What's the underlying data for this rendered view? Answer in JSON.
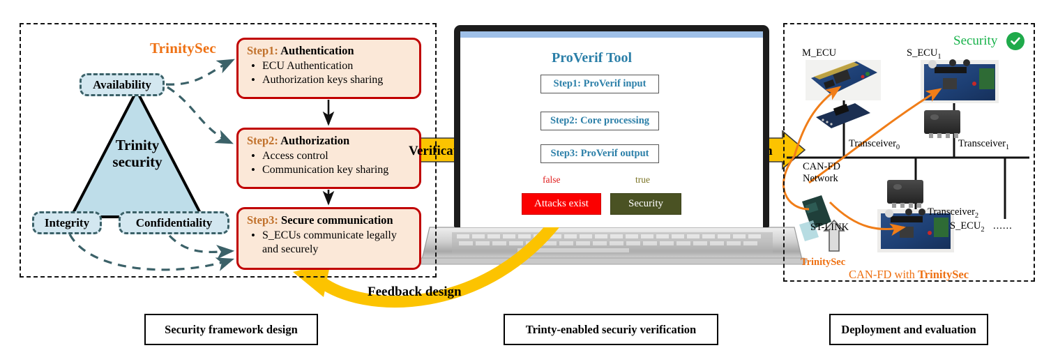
{
  "panel1": {
    "framework_title": "TrinitySec",
    "triangle_label_line1": "Trinity",
    "triangle_label_line2": "security",
    "pillars": [
      {
        "label": "Availability"
      },
      {
        "label": "Integrity"
      },
      {
        "label": "Confidentiality"
      }
    ],
    "steps": [
      {
        "step_key": "Step1:",
        "step_title": "Authentication",
        "bullets": [
          "ECU Authentication",
          "Authorization keys sharing"
        ]
      },
      {
        "step_key": "Step2:",
        "step_title": "Authorization",
        "bullets": [
          "Access control",
          "Communication key sharing"
        ]
      },
      {
        "step_key": "Step3:",
        "step_title": "Secure communication",
        "bullets": [
          "S_ECUs communicate legally and securely"
        ]
      }
    ]
  },
  "arrows": {
    "verification_label": "Verification",
    "evaluation_label": "Evaluation",
    "feedback_label": "Feedback design"
  },
  "panel2": {
    "tool_title": "ProVerif Tool",
    "flow_steps": [
      "Step1: ProVerif input",
      "Step2: Core processing",
      "Step3: ProVerif output"
    ],
    "branch_false_label": "false",
    "branch_true_label": "true",
    "result_false": "Attacks exist",
    "result_true": "Security"
  },
  "panel3": {
    "security_label": "Security",
    "check_icon": "check-icon",
    "m_ecu_label": "M_ECU",
    "s_ecu1_label": "S_ECU",
    "s_ecu1_sub": "1",
    "s_ecu2_label": "S_ECU",
    "s_ecu2_sub": "2",
    "ellipsis": "......",
    "transceiver0_label": "Transceiver",
    "transceiver0_sub": "0",
    "transceiver1_label": "Transceiver",
    "transceiver1_sub": "1",
    "transceiver2_label": "Transceiver",
    "transceiver2_sub": "2",
    "network_line1": "CAN-FD",
    "network_line2": "Network",
    "stlink_label": "ST-LINK",
    "trinitysec_tag": "TrinitySec",
    "footer_prefix": "CAN-FD with ",
    "footer_bold": "TrinitySec"
  },
  "captions": {
    "left": "Security framework design",
    "middle": "Trinty-enabled securiy verification",
    "right": "Deployment and evaluation"
  },
  "colors": {
    "accent_orange": "#ee7012",
    "step_border_red": "#c00000",
    "step_fill": "#fbe8d8",
    "pill_fill": "#d3e7f0",
    "pill_border": "#3b6168",
    "triangle_fill": "#bedde9",
    "proverif_blue": "#2b7fa8",
    "attack_red": "#fb0000",
    "security_olive": "#4a5223",
    "banner_yellow": "#fcc300",
    "check_green": "#1faa4b"
  }
}
